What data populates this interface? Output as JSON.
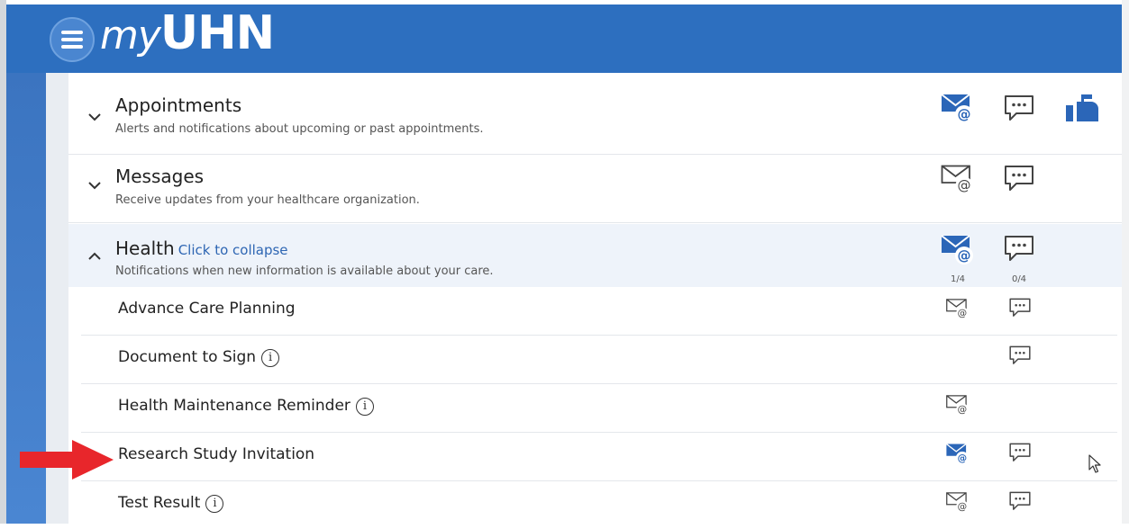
{
  "header": {
    "logo_prefix": "my",
    "logo_suffix": "UHN"
  },
  "sections": {
    "appointments": {
      "title": "Appointments",
      "description": "Alerts and notifications about upcoming or past appointments.",
      "icons": [
        "email-icon",
        "sms-icon",
        "mailbox-icon"
      ]
    },
    "messages": {
      "title": "Messages",
      "description": "Receive updates from your healthcare organization.",
      "icons": [
        "email-icon",
        "sms-icon"
      ]
    },
    "health": {
      "title": "Health",
      "collapse_link": "Click to collapse",
      "description": "Notifications when new information is available about your care.",
      "email_count": "1/4",
      "sms_count": "0/4",
      "items": [
        {
          "label": "Advance Care Planning"
        },
        {
          "label": "Document to Sign"
        },
        {
          "label": "Health Maintenance Reminder"
        },
        {
          "label": "Research Study Invitation"
        },
        {
          "label": "Test Result"
        }
      ]
    }
  },
  "info_glyph": "i",
  "colors": {
    "header": "#2d6fbf",
    "accent": "#2e66b3",
    "active_icon": "#2b66b8",
    "arrow": "#e8262b"
  }
}
